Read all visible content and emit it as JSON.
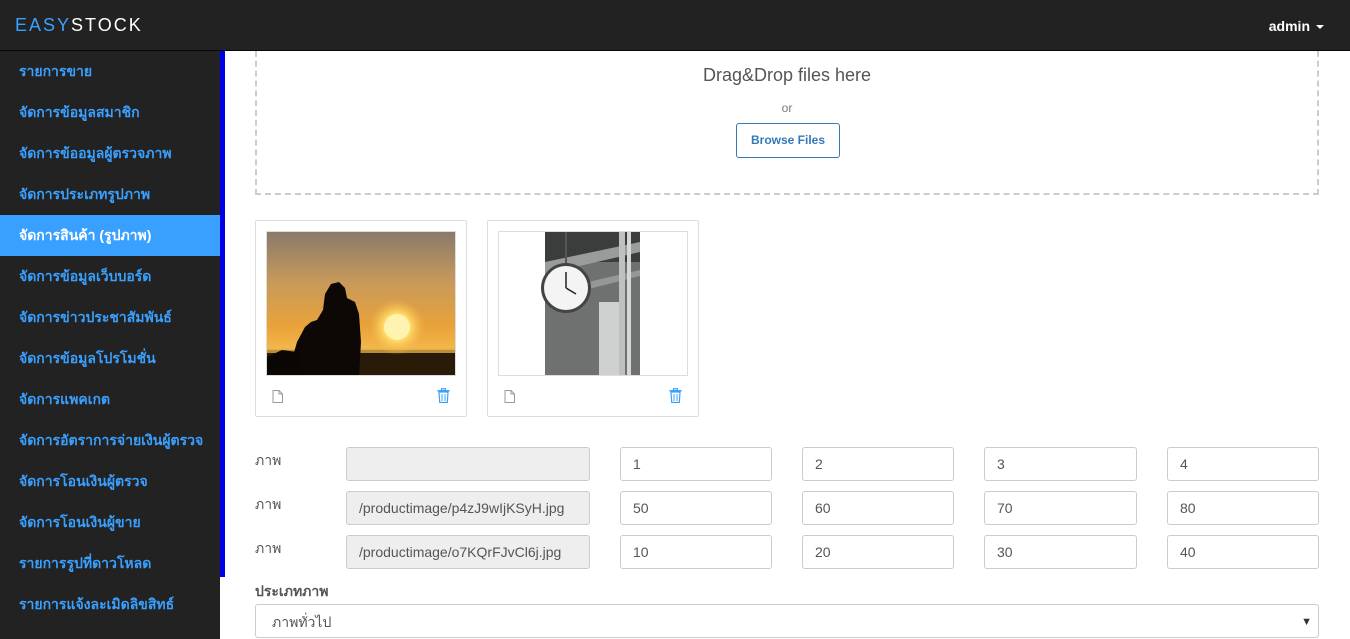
{
  "brand": {
    "part1": "EASY",
    "part2": "STOCK"
  },
  "user": {
    "name": "admin"
  },
  "sidebar": {
    "items": [
      {
        "label": "รายการขาย"
      },
      {
        "label": "จัดการข้อมูลสมาชิก"
      },
      {
        "label": "จัดการข้ออมูลผู้ตรวจภาพ"
      },
      {
        "label": "จัดการประเภทรูปภาพ"
      },
      {
        "label": "จัดการสินค้า (รูปภาพ)",
        "active": true
      },
      {
        "label": "จัดการข้อมูลเว็บบอร์ด"
      },
      {
        "label": "จัดการข่าวประชาสัมพันธ์"
      },
      {
        "label": "จัดการข้อมูลโปรโมชั่น"
      },
      {
        "label": "จัดการแพคเกต"
      },
      {
        "label": "จัดการอัตราการจ่ายเงินผู้ตรวจ"
      },
      {
        "label": "จัดการโอนเงินผู้ตรวจ"
      },
      {
        "label": "จัดการโอนเงินผู้ขาย"
      },
      {
        "label": "รายการรูปที่ดาวโหลด"
      },
      {
        "label": "รายการแจ้งละเมิดลิขสิทธ์"
      }
    ]
  },
  "upload": {
    "title": "Drag&Drop files here",
    "or": "or",
    "browse_label": "Browse Files"
  },
  "thumbnails": [
    {
      "icon_file": "file-icon",
      "icon_delete": "trash-icon"
    },
    {
      "icon_file": "file-icon",
      "icon_delete": "trash-icon"
    }
  ],
  "rows": [
    {
      "label": "ภาพ",
      "path": "",
      "values": [
        "1",
        "2",
        "3",
        "4"
      ]
    },
    {
      "label": "ภาพ",
      "path": "/productimage/p4zJ9wIjKSyH.jpg",
      "values": [
        "50",
        "60",
        "70",
        "80"
      ]
    },
    {
      "label": "ภาพ",
      "path": "/productimage/o7KQrFJvCl6j.jpg",
      "values": [
        "10",
        "20",
        "30",
        "40"
      ]
    }
  ],
  "category": {
    "label": "ประเภทภาพ",
    "selected": "ภาพทั่วไป"
  },
  "colors": {
    "accent": "#3aa0ff",
    "navbar": "#222222",
    "sidebar_edge": "#0000e6"
  }
}
